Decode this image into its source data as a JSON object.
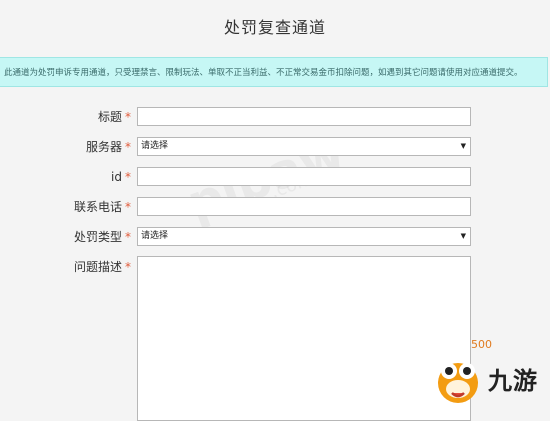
{
  "page": {
    "title": "处罚复查通道",
    "notice": "此通道为处罚申诉专用通道，只受理禁言、限制玩法、单取不正当利益、不正常交易金币扣除问题，如遇到其它问题请使用对应通道提交。"
  },
  "form": {
    "required_mark": "*",
    "title_label": "标题",
    "title_value": "",
    "server_label": "服务器",
    "server_value": "请选择",
    "id_label": "id",
    "id_value": "",
    "phone_label": "联系电话",
    "phone_value": "",
    "penalty_type_label": "处罚类型",
    "penalty_type_value": "请选择",
    "description_label": "问题描述",
    "description_value": "",
    "char_counter": "500"
  },
  "branding": {
    "watermark": "pipaw",
    "watermark_sub": ".com",
    "logo_text": "九游",
    "logo_icon": "mascot-icon"
  },
  "colors": {
    "notice_bg": "#c6f7f5",
    "required": "#e05a3a",
    "counter": "#e07b20",
    "logo_orange": "#f39c12"
  }
}
